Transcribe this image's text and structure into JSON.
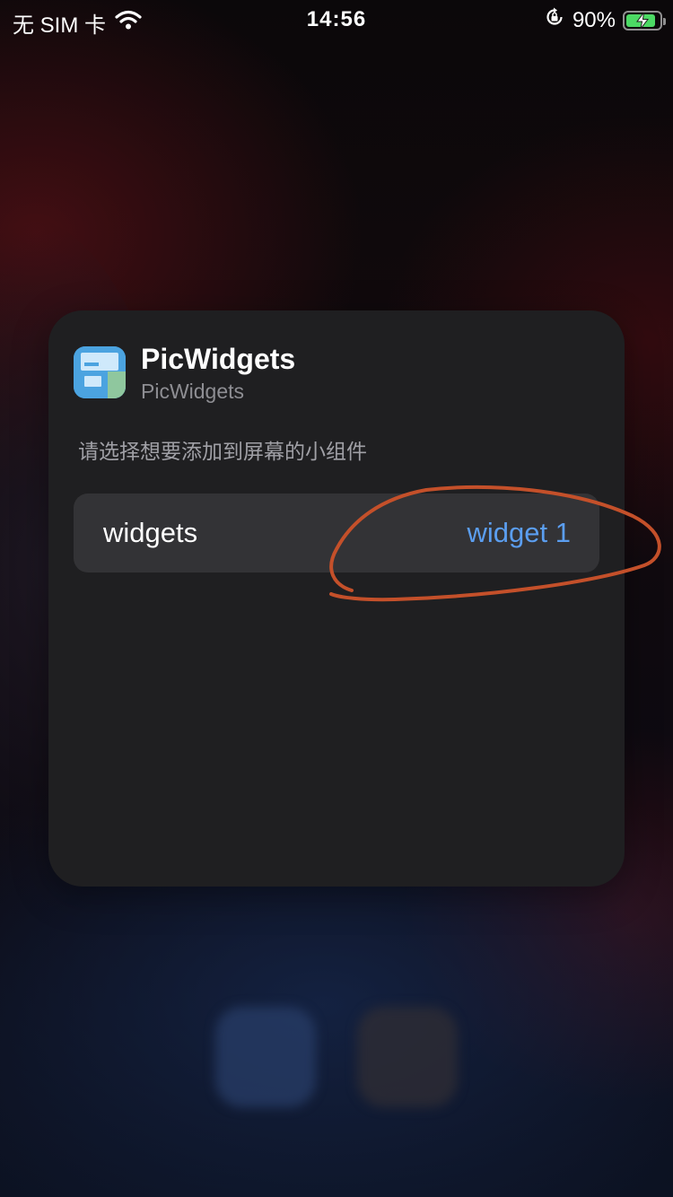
{
  "status_bar": {
    "carrier": "无 SIM 卡",
    "time": "14:56",
    "battery_percent": "90%",
    "battery_level": 0.9,
    "icons": [
      "wifi-icon",
      "orientation-lock-icon",
      "battery-charging-icon"
    ]
  },
  "widget_card": {
    "app_icon": "picwidgets-app-icon",
    "app_name": "PicWidgets",
    "app_subtitle": "PicWidgets",
    "prompt": "请选择想要添加到屏幕的小组件",
    "row": {
      "label": "widgets",
      "value": "widget 1"
    }
  },
  "colors": {
    "card_background": "#1f1f21",
    "row_background": "#333336",
    "accent_blue": "#5b9ef0",
    "secondary_text": "#8e8e93",
    "annotation_stroke": "#c4502a",
    "battery_green": "#4cd964"
  }
}
